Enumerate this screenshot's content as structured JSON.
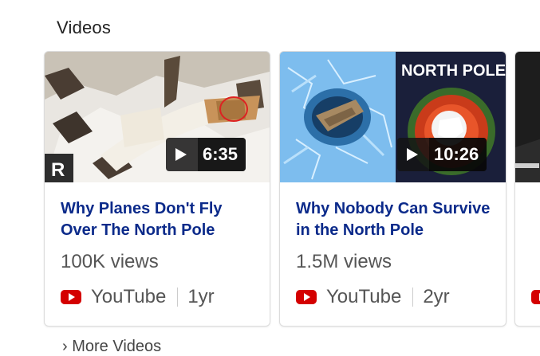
{
  "section": {
    "title": "Videos"
  },
  "videos": [
    {
      "title": "Why Planes Don't Fly Over The North Pole",
      "duration": "6:35",
      "views": "100K views",
      "source": "YouTube",
      "age": "1yr"
    },
    {
      "title": "Why Nobody Can Survive in the North Pole",
      "duration": "10:26",
      "views": "1.5M views",
      "source": "YouTube",
      "age": "2yr",
      "thumb_text": "NORTH POLE"
    },
    {
      "title": "",
      "duration": "",
      "views": "",
      "source": "",
      "age": ""
    }
  ],
  "more_link": "› More Videos",
  "icons": {
    "play": "play-icon",
    "youtube": "youtube-logo-icon"
  },
  "colors": {
    "title_link": "#0b2a8a",
    "youtube_red": "#d40000",
    "card_border": "#dcdcdc"
  }
}
